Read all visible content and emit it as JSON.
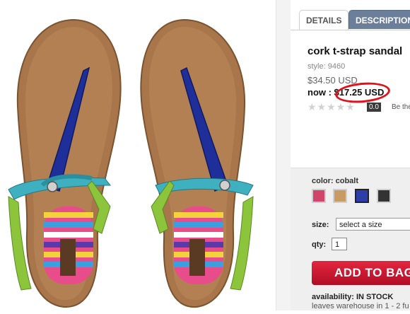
{
  "tabs": [
    {
      "label": "DETAILS",
      "active": true
    },
    {
      "label": "DESCRIPTION",
      "active": false
    }
  ],
  "product": {
    "title": "cork t-strap sandal",
    "style": "style: 9460",
    "original_price": "$34.50 USD",
    "now_label": "now : ",
    "sale_price": "$17.25 USD",
    "stars": "★★★★★",
    "rating": "0.0",
    "review_link": "Be the"
  },
  "options": {
    "color_label": "color: cobalt",
    "swatches": [
      {
        "name": "pink",
        "color": "#d2456a",
        "selected": false
      },
      {
        "name": "cork",
        "color": "#c89a64",
        "selected": false
      },
      {
        "name": "cobalt",
        "color": "#2c3fa6",
        "selected": true
      },
      {
        "name": "black",
        "color": "#333333",
        "selected": false
      }
    ],
    "size_label": "size:",
    "size_placeholder": "select a size",
    "qty_label": "qty:",
    "qty_value": "1"
  },
  "cart": {
    "add_label": "ADD TO BAG"
  },
  "availability": {
    "label": "availability:",
    "status": "IN STOCK",
    "note": "leaves warehouse in 1 - 2 fu"
  },
  "colors": {
    "accent_red": "#c8102e",
    "tab_active_bg": "#6b7e9a",
    "circle": "#e0121c"
  },
  "icons": [
    "sandal-product-image",
    "star-icon",
    "dropdown-arrow-icon"
  ]
}
